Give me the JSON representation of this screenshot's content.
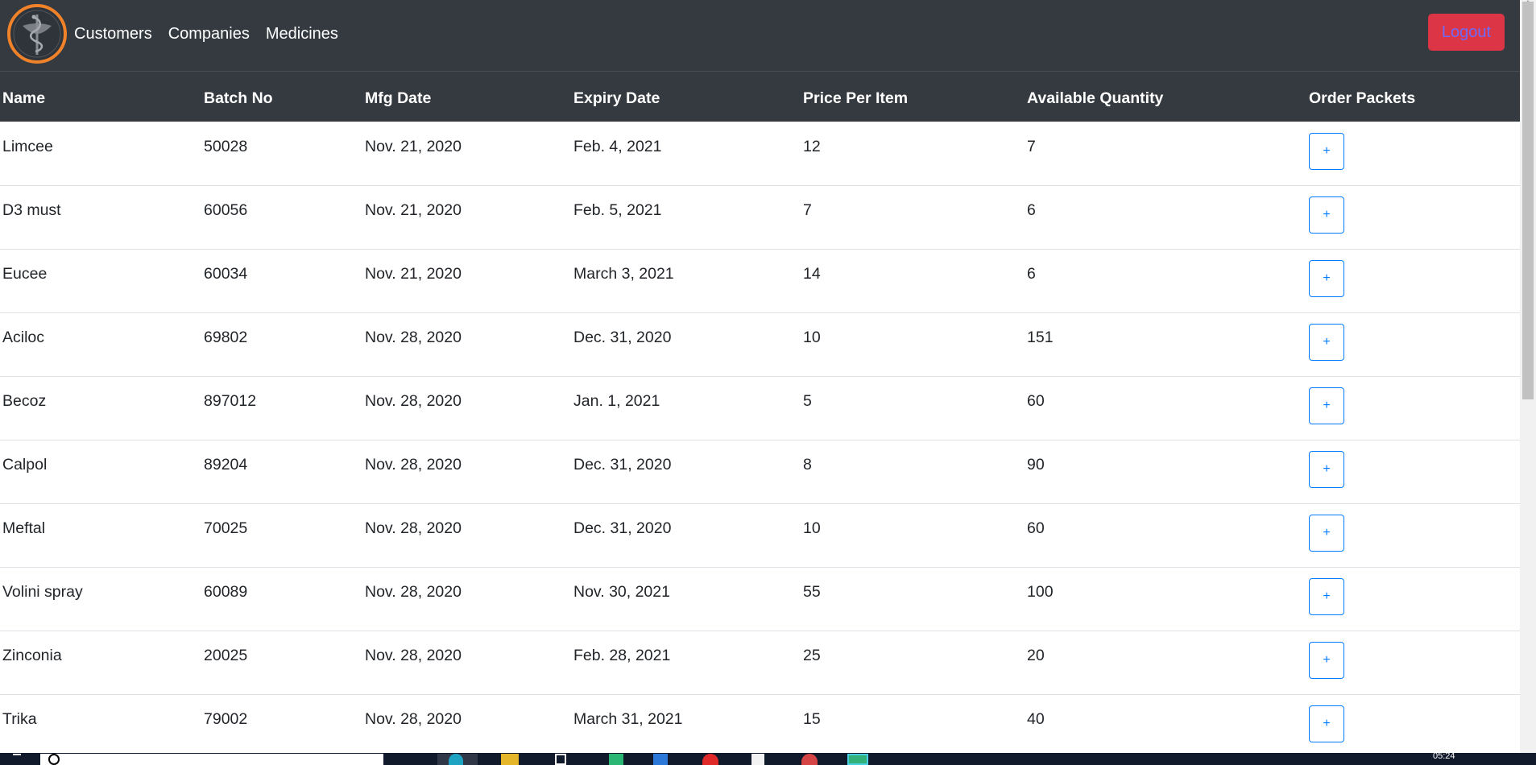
{
  "nav": {
    "links": [
      "Customers",
      "Companies",
      "Medicines"
    ],
    "logout_label": "Logout"
  },
  "table": {
    "headers": [
      "Name",
      "Batch No",
      "Mfg Date",
      "Expiry Date",
      "Price Per Item",
      "Available Quantity",
      "Order Packets"
    ],
    "rows": [
      {
        "name": "Limcee",
        "batch": "50028",
        "mfg": "Nov. 21, 2020",
        "expiry": "Feb. 4, 2021",
        "price": "12",
        "qty": "7"
      },
      {
        "name": "D3 must",
        "batch": "60056",
        "mfg": "Nov. 21, 2020",
        "expiry": "Feb. 5, 2021",
        "price": "7",
        "qty": "6"
      },
      {
        "name": "Eucee",
        "batch": "60034",
        "mfg": "Nov. 21, 2020",
        "expiry": "March 3, 2021",
        "price": "14",
        "qty": "6"
      },
      {
        "name": "Aciloc",
        "batch": "69802",
        "mfg": "Nov. 28, 2020",
        "expiry": "Dec. 31, 2020",
        "price": "10",
        "qty": "151"
      },
      {
        "name": "Becoz",
        "batch": "897012",
        "mfg": "Nov. 28, 2020",
        "expiry": "Jan. 1, 2021",
        "price": "5",
        "qty": "60"
      },
      {
        "name": "Calpol",
        "batch": "89204",
        "mfg": "Nov. 28, 2020",
        "expiry": "Dec. 31, 2020",
        "price": "8",
        "qty": "90"
      },
      {
        "name": "Meftal",
        "batch": "70025",
        "mfg": "Nov. 28, 2020",
        "expiry": "Dec. 31, 2020",
        "price": "10",
        "qty": "60"
      },
      {
        "name": "Volini spray",
        "batch": "60089",
        "mfg": "Nov. 28, 2020",
        "expiry": "Nov. 30, 2021",
        "price": "55",
        "qty": "100"
      },
      {
        "name": "Zinconia",
        "batch": "20025",
        "mfg": "Nov. 28, 2020",
        "expiry": "Feb. 28, 2021",
        "price": "25",
        "qty": "20"
      },
      {
        "name": "Trika",
        "batch": "79002",
        "mfg": "Nov. 28, 2020",
        "expiry": "March 31, 2021",
        "price": "15",
        "qty": "40"
      }
    ],
    "order_button_label": "+"
  },
  "taskbar": {
    "time": "05:24"
  },
  "colors": {
    "navbar": "#343a40",
    "logout": "#dc3545",
    "logout_text": "#6f6af8",
    "accent_blue": "#007bff",
    "logo_orange": "#f0822a"
  },
  "icons": [
    "pharmacy-logo-icon",
    "plus-icon",
    "scrollbar-arrow-icon"
  ]
}
